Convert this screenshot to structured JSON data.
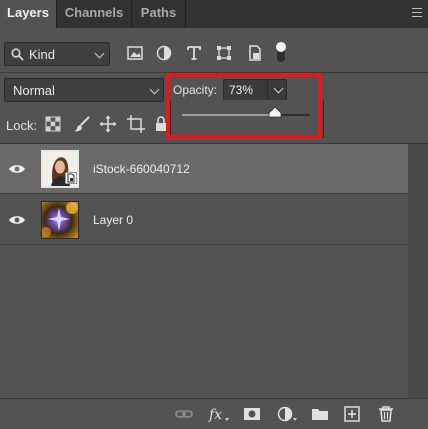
{
  "tabs": [
    {
      "label": "Layers",
      "active": true
    },
    {
      "label": "Channels",
      "active": false
    },
    {
      "label": "Paths",
      "active": false
    }
  ],
  "filter": {
    "kind_label": "Kind",
    "icons": [
      "image-filter-icon",
      "adjustment-filter-icon",
      "type-filter-icon",
      "shape-filter-icon",
      "smart-object-filter-icon",
      "filter-toggle-icon"
    ]
  },
  "blend": {
    "mode": "Normal",
    "opacity_label": "Opacity:",
    "opacity_value": "73%",
    "opacity_fraction": 0.73
  },
  "lock": {
    "label": "Lock:",
    "icons": [
      "lock-transparent-pixels-icon",
      "lock-image-pixels-icon",
      "lock-position-icon",
      "prevent-autonest-icon",
      "lock-all-icon"
    ]
  },
  "layers": [
    {
      "name": "iStock-660040712",
      "visible": true,
      "selected": true,
      "type": "smart-object"
    },
    {
      "name": "Layer 0",
      "visible": true,
      "selected": false,
      "type": "pixel"
    }
  ],
  "bottom_icons": [
    "link-layers-icon",
    "fx-icon",
    "add-mask-icon",
    "new-adjustment-layer-icon",
    "new-group-icon",
    "new-layer-icon",
    "delete-layer-icon"
  ],
  "colors": {
    "panel_bg": "#535353",
    "tabbar_bg": "#323232",
    "selected_row": "#6a6a6a",
    "highlight": "#e3171c"
  }
}
